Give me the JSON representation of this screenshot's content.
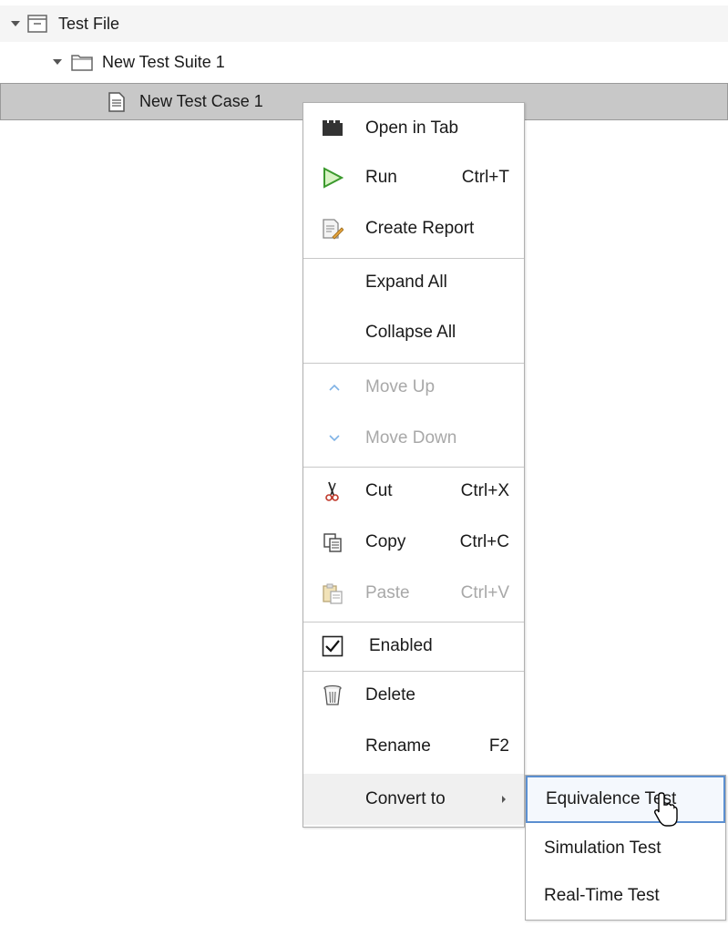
{
  "tree": {
    "items": [
      {
        "label": "Test File",
        "icon": "test-file-icon",
        "expanded": true
      },
      {
        "label": "New Test Suite 1",
        "icon": "folder-icon",
        "expanded": true
      },
      {
        "label": "New Test Case 1",
        "icon": "document-icon",
        "selected": true
      }
    ]
  },
  "context_menu": {
    "open_in_tab": {
      "label": "Open in Tab",
      "icon": "open-in-tab-icon"
    },
    "run": {
      "label": "Run",
      "shortcut": "Ctrl+T",
      "icon": "run-play-icon"
    },
    "create_report": {
      "label": "Create Report",
      "icon": "report-icon"
    },
    "expand_all": {
      "label": "Expand All"
    },
    "collapse_all": {
      "label": "Collapse All"
    },
    "move_up": {
      "label": "Move Up",
      "icon": "chevron-up-icon",
      "enabled": false
    },
    "move_down": {
      "label": "Move Down",
      "icon": "chevron-down-icon",
      "enabled": false
    },
    "cut": {
      "label": "Cut",
      "shortcut": "Ctrl+X",
      "icon": "scissors-icon"
    },
    "copy": {
      "label": "Copy",
      "shortcut": "Ctrl+C",
      "icon": "copy-icon"
    },
    "paste": {
      "label": "Paste",
      "shortcut": "Ctrl+V",
      "icon": "paste-icon",
      "enabled": false
    },
    "enabled": {
      "label": "Enabled",
      "checked": true
    },
    "delete": {
      "label": "Delete",
      "icon": "trash-icon"
    },
    "rename": {
      "label": "Rename",
      "shortcut": "F2"
    },
    "convert_to": {
      "label": "Convert to",
      "has_submenu": true
    }
  },
  "submenu": {
    "items": [
      {
        "label": "Equivalence Test",
        "highlighted": true
      },
      {
        "label": "Simulation Test"
      },
      {
        "label": "Real-Time Test"
      }
    ]
  },
  "colors": {
    "selection_row": "#c8c8c8",
    "run_icon": "#4caf50",
    "disabled_text": "#a8a8a8",
    "submenu_highlight_border": "#5b8fd0"
  }
}
